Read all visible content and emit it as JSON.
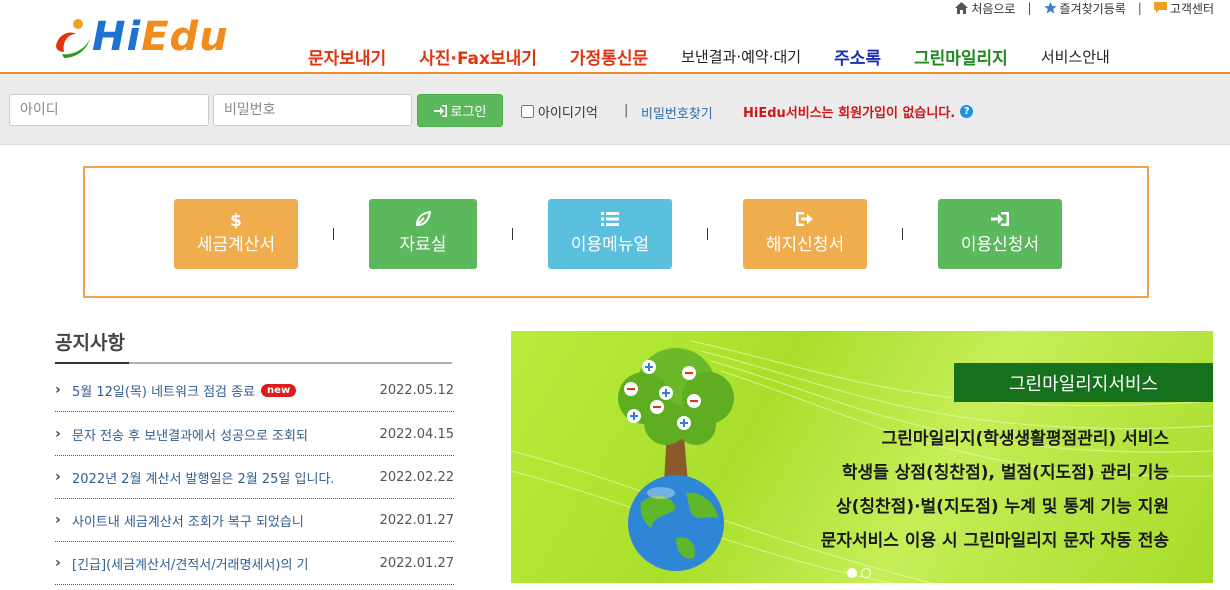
{
  "logo": {
    "text_hi": "Hi",
    "text_edu": "Edu"
  },
  "utility": [
    {
      "label": "처음으로",
      "icon": "home-icon"
    },
    {
      "label": "즐겨찾기등록",
      "icon": "star-icon"
    },
    {
      "label": "고객센터",
      "icon": "chat-icon"
    }
  ],
  "gnb": [
    {
      "label": "문자보내기"
    },
    {
      "label": "사진·Fax보내기"
    },
    {
      "label": "가정통신문"
    },
    {
      "label": "보낸결과·예약·대기"
    },
    {
      "label": "주소록"
    },
    {
      "label": "그린마일리지"
    },
    {
      "label": "서비스안내"
    }
  ],
  "login": {
    "id_placeholder": "아이디",
    "pw_placeholder": "비밀번호",
    "login_label": "로그인",
    "remember_label": "아이디기억",
    "separator": "|",
    "find_pw_label": "비밀번호찾기",
    "no_join_text": "HiEdu서비스는 회원가입이 없습니다.",
    "help_glyph": "?"
  },
  "quick_menu": [
    {
      "label": "세금계산서",
      "icon": "dollar-icon",
      "glyph": "$",
      "color": "#f0ad4e"
    },
    {
      "label": "자료실",
      "icon": "leaf-icon",
      "glyph": "❦",
      "color": "#5cb85c"
    },
    {
      "label": "이용메뉴얼",
      "icon": "list-icon",
      "glyph": "☰",
      "color": "#5bc0de"
    },
    {
      "label": "해지신청서",
      "icon": "sign-out-icon",
      "glyph": "⇥",
      "color": "#f0ad4e"
    },
    {
      "label": "이용신청서",
      "icon": "sign-in-icon",
      "glyph": "⇲",
      "color": "#5cb85c"
    }
  ],
  "quick_separator": "|",
  "notice": {
    "title": "공지사항",
    "new_badge": "new",
    "items": [
      {
        "title": "5월 12일(목) 네트워크 점검 종료",
        "date": "2022.05.12",
        "is_new": true
      },
      {
        "title": "문자 전송 후 보낸결과에서 성공으로 조회되",
        "date": "2022.04.15",
        "is_new": false
      },
      {
        "title": "2022년 2월 계산서 발행일은 2월 25일 입니다.",
        "date": "2022.02.22",
        "is_new": false
      },
      {
        "title": "사이트내 세금계산서 조회가 복구 되었습니",
        "date": "2022.01.27",
        "is_new": false
      },
      {
        "title": "[긴급](세금계산서/견적서/거래명세서)의 기",
        "date": "2022.01.27",
        "is_new": false
      }
    ]
  },
  "banner": {
    "title": "그린마일리지서비스",
    "lines": [
      "그린마일리지(학생생활평점관리) 서비스",
      "학생들 상점(칭찬점), 벌점(지도점) 관리 기능",
      "상(칭찬점)·벌(지도점) 누계 및 통계 기능 지원",
      "문자서비스 이용 시 그린마일리지 문자 자동 전송"
    ],
    "slide_count": 2,
    "active_slide": 1
  },
  "colors": {
    "accent_orange": "#f08a2a",
    "brand_blue": "#1e73d2",
    "brand_orange": "#f08c1e",
    "banner_title_bg": "#16711d"
  }
}
